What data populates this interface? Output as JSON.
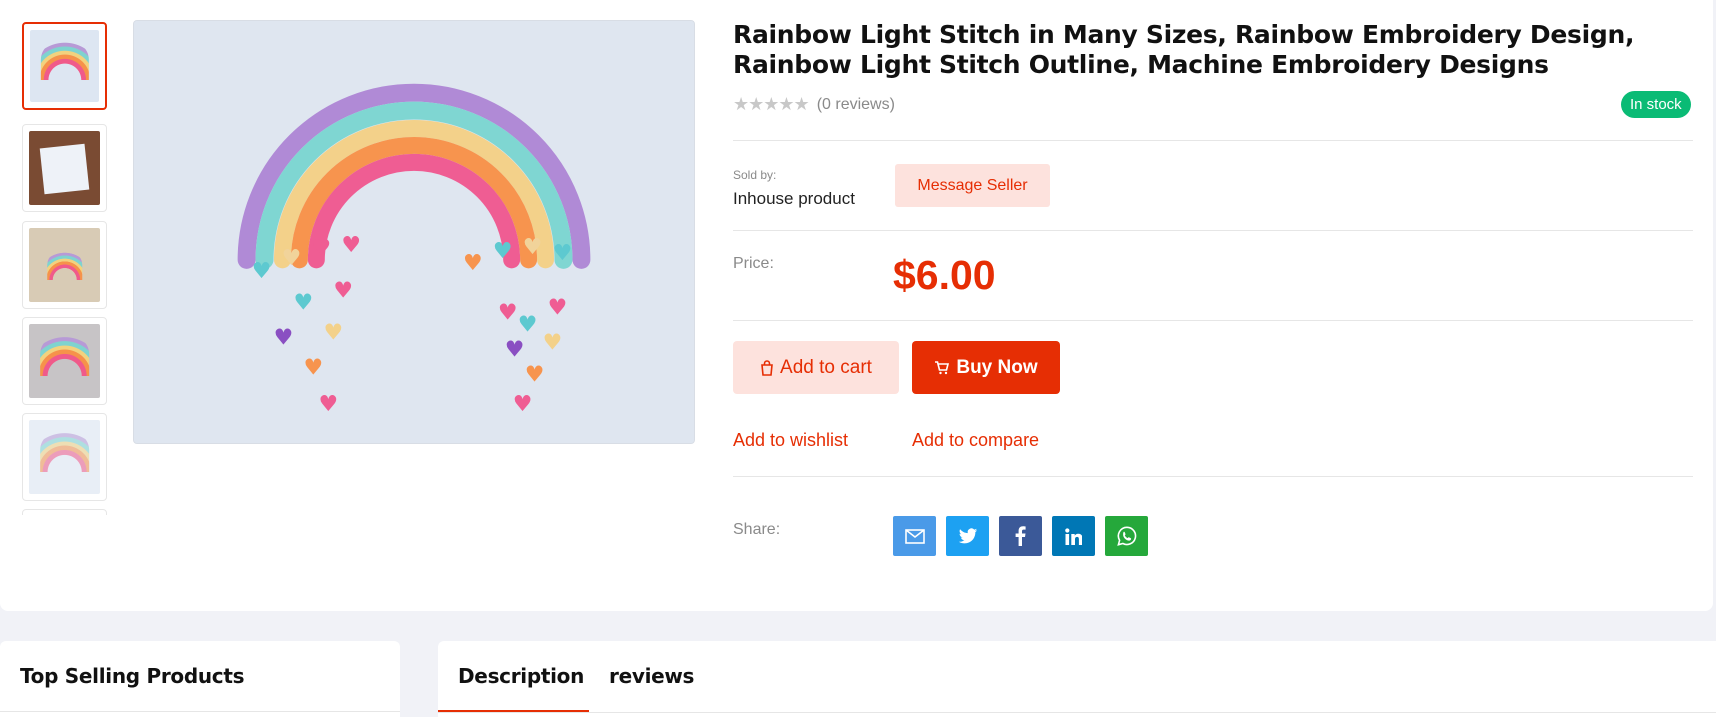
{
  "product": {
    "title": "Rainbow Light Stitch in Many Sizes, Rainbow Embroidery Design, Rainbow Light Stitch Outline, Machine Embroidery Designs",
    "rating_stars": "★★★★★",
    "reviews_count": "(0 reviews)",
    "stock_badge": "In stock",
    "sold_by_label": "Sold by:",
    "sold_by_value": "Inhouse product",
    "message_seller": "Message Seller",
    "price_label": "Price:",
    "price_value": "$6.00",
    "add_to_cart": "Add to cart",
    "buy_now": "Buy Now",
    "add_to_wishlist": "Add to wishlist",
    "add_to_compare": "Add to compare",
    "share_label": "Share:",
    "share_buttons": [
      {
        "name": "email",
        "color": "#4a9ae8"
      },
      {
        "name": "twitter",
        "color": "#1da1f2"
      },
      {
        "name": "facebook",
        "color": "#3b5998"
      },
      {
        "name": "linkedin",
        "color": "#0077b5"
      },
      {
        "name": "whatsapp",
        "color": "#25a83b"
      }
    ]
  },
  "thumbnails": [
    {
      "id": "thumb-1",
      "active": true
    },
    {
      "id": "thumb-2",
      "active": false
    },
    {
      "id": "thumb-3",
      "active": false
    },
    {
      "id": "thumb-4",
      "active": false
    },
    {
      "id": "thumb-5",
      "active": false
    }
  ],
  "sidebar": {
    "title": "Top Selling Products"
  },
  "tabs": [
    {
      "label": "Description",
      "active": true
    },
    {
      "label": "reviews",
      "active": false
    }
  ],
  "colors": {
    "accent": "#e62e04",
    "accent_light": "#fde2dd",
    "stock_green": "#0abb75"
  }
}
